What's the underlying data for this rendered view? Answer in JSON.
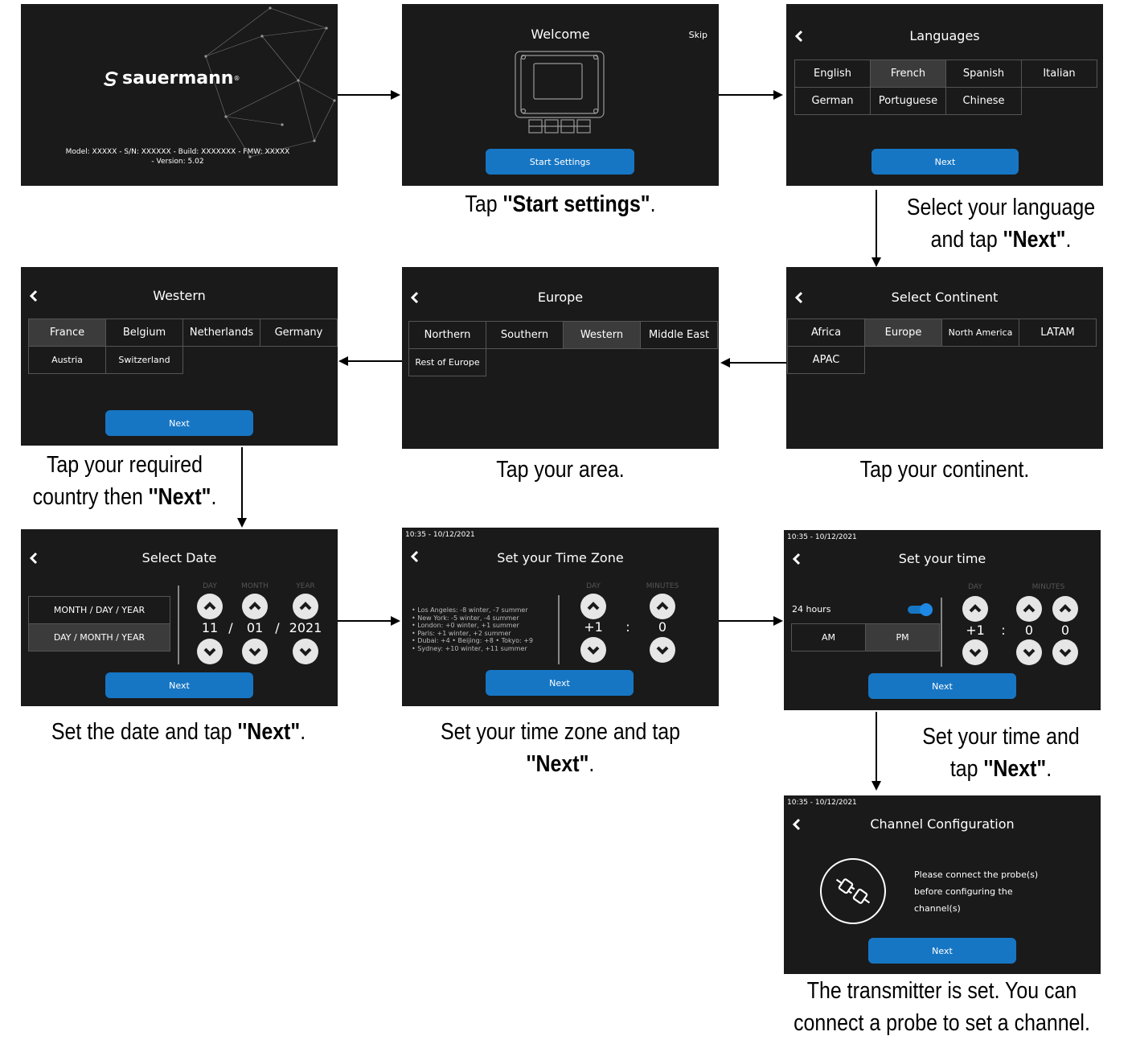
{
  "s1": {
    "brand": "sauermann",
    "info": "Model: XXXXX - S/N: XXXXXX - Build: XXXXXXX - FMW: XXXXX - Version: 5.02"
  },
  "s2": {
    "title": "Welcome",
    "skip": "Skip",
    "button": "Start Settings",
    "caption_pre": "Tap ",
    "caption_bold": "''Start settings\"",
    "caption_post": "."
  },
  "s3": {
    "title": "Languages",
    "items": [
      "English",
      "French",
      "Spanish",
      "Italian",
      "German",
      "Portuguese",
      "Chinese"
    ],
    "button": "Next",
    "caption_line1": "Select your language",
    "caption_pre": "and tap ",
    "caption_bold": "''Next\"",
    "caption_post": "."
  },
  "s4": {
    "title": "Select Continent",
    "items": [
      "Africa",
      "Europe",
      "North America",
      "LATAM",
      "APAC"
    ],
    "caption": "Tap your continent."
  },
  "s5": {
    "title": "Europe",
    "items": [
      "Northern",
      "Southern",
      "Western",
      "Middle East",
      "Rest of Europe"
    ],
    "caption": "Tap your area."
  },
  "s6": {
    "title": "Western",
    "items": [
      "France",
      "Belgium",
      "Netherlands",
      "Germany",
      "Austria",
      "Switzerland"
    ],
    "button": "Next",
    "caption_line1": "Tap your required",
    "caption_pre": "country then ",
    "caption_bold": "''Next\"",
    "caption_post": "."
  },
  "s7": {
    "title": "Select Date",
    "options": [
      "MONTH / DAY / YEAR",
      "DAY / MONTH / YEAR"
    ],
    "labels": [
      "DAY",
      "MONTH",
      "YEAR"
    ],
    "values": [
      "11",
      "01",
      "2021"
    ],
    "sep": "/",
    "button": "Next",
    "caption_pre": "Set the date and tap ",
    "caption_bold": "''Next\"",
    "caption_post": "."
  },
  "s8": {
    "timestamp": "10:35 - 10/12/2021",
    "title": "Set your Time Zone",
    "zones": [
      "• Los Angeles: -8 winter, -7 summer",
      "• New York: -5 winter, -4 summer",
      "• London: +0 winter, +1 summer",
      "• Paris: +1 winter, +2 summer",
      "• Dubai: +4  • Beijing: +8  • Tokyo: +9",
      "• Sydney: +10 winter, +11 summer"
    ],
    "labels": [
      "DAY",
      "MINUTES"
    ],
    "values": [
      "+1",
      "0"
    ],
    "sep": ":",
    "button": "Next",
    "caption_line1": "Set your time zone and tap",
    "caption_bold": "''Next\"",
    "caption_post": "."
  },
  "s9": {
    "timestamp": "10:35 - 10/12/2021",
    "title": "Set your time",
    "toggle_label": "24 hours",
    "am": "AM",
    "pm": "PM",
    "labels": [
      "DAY",
      "MINUTES"
    ],
    "values": [
      "+1",
      "0",
      "0"
    ],
    "sep": ":",
    "button": "Next",
    "caption_line1": "Set your time and",
    "caption_pre": "tap ",
    "caption_bold": "''Next\"",
    "caption_post": "."
  },
  "s10": {
    "timestamp": "10:35 - 10/12/2021",
    "title": "Channel Configuration",
    "message": [
      "Please connect the probe(s)",
      "before configuring the",
      "channel(s)"
    ],
    "button": "Next",
    "caption_line1": "The transmitter is set. You can",
    "caption_line2": "connect a probe to set a channel."
  },
  "colors": {
    "screen_bg": "#1a1a1a",
    "accent": "#1776c4",
    "selected_cell": "#3b3b3b"
  }
}
